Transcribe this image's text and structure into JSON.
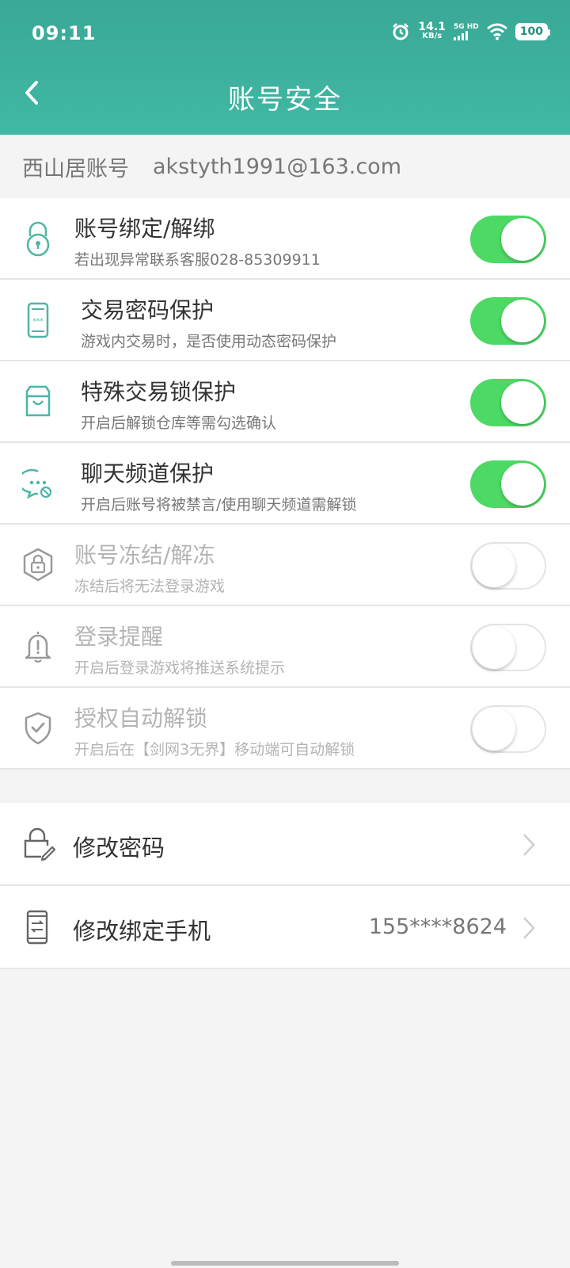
{
  "status": {
    "time": "09:11",
    "speed_value": "14.1",
    "speed_unit": "KB/s",
    "network": "5G HD",
    "battery": "100"
  },
  "header": {
    "title": "账号安全"
  },
  "account": {
    "label": "西山居账号",
    "email": "akstyth1991@163.com"
  },
  "settings": [
    {
      "title": "账号绑定/解绑",
      "desc": "若出现异常联系客服028-85309911",
      "on": true,
      "icon": "lock-pin-icon"
    },
    {
      "title": "交易密码保护",
      "desc": "游戏内交易时，是否使用动态密码保护",
      "on": true,
      "icon": "phone-password-icon"
    },
    {
      "title": "特殊交易锁保护",
      "desc": "开启后解锁仓库等需勾选确认",
      "on": true,
      "icon": "store-icon"
    },
    {
      "title": "聊天频道保护",
      "desc": "开启后账号将被禁言/使用聊天频道需解锁",
      "on": true,
      "icon": "chat-block-icon"
    },
    {
      "title": "账号冻结/解冻",
      "desc": "冻结后将无法登录游戏",
      "on": false,
      "icon": "hex-lock-icon"
    },
    {
      "title": "登录提醒",
      "desc": "开启后登录游戏将推送系统提示",
      "on": false,
      "icon": "bell-alert-icon"
    },
    {
      "title": "授权自动解锁",
      "desc": "开启后在【剑网3无界】移动端可自动解锁",
      "on": false,
      "icon": "shield-check-icon"
    }
  ],
  "actions": {
    "change_password": "修改密码",
    "change_phone": "修改绑定手机",
    "phone_number": "155****8624"
  },
  "colors": {
    "accent": "#3db29e",
    "toggle_on": "#4cd964"
  }
}
